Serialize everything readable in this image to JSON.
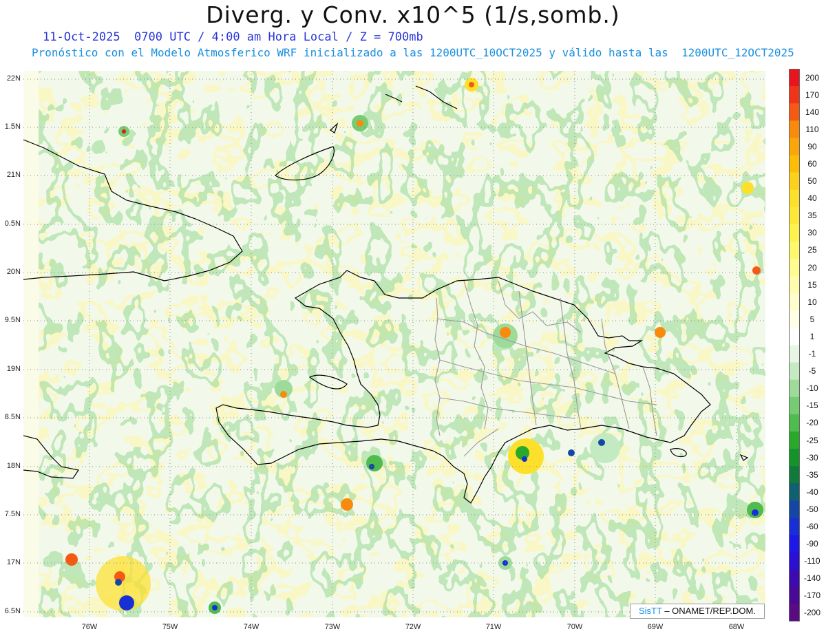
{
  "header": {
    "title": "Diverg. y Conv. x10^5 (1/s,somb.)",
    "subtitle_time": "11-Oct-2025  0700 UTC / 4:00 am Hora Local / Z = 700mb",
    "subtitle_model": "Pronóstico con el Modelo Atmosferico WRF inicializado a las 1200UTC_10OCT2025 y válido hasta las  1200UTC_12OCT2025"
  },
  "axes": {
    "lat_labels": [
      "22N",
      "1.5N",
      "21N",
      "0.5N",
      "20N",
      "9.5N",
      "19N",
      "8.5N",
      "18N",
      "7.5N",
      "17N",
      "6.5N"
    ],
    "lon_labels": [
      "76W",
      "75W",
      "74W",
      "73W",
      "72W",
      "71W",
      "70W",
      "69W",
      "68W"
    ]
  },
  "credit": {
    "brand": "SisTT",
    "text": " – ONAMET/REP.DOM."
  },
  "colorbar": {
    "labels": [
      "200",
      "170",
      "140",
      "110",
      "90",
      "60",
      "50",
      "40",
      "35",
      "30",
      "25",
      "20",
      "15",
      "10",
      "5",
      "1",
      "-1",
      "-5",
      "-10",
      "-15",
      "-20",
      "-25",
      "-30",
      "-35",
      "-40",
      "-50",
      "-60",
      "-90",
      "-110",
      "-140",
      "-170",
      "-200"
    ],
    "colors": [
      "#e8141e",
      "#f03419",
      "#f55a14",
      "#f88a0e",
      "#faa50a",
      "#fbbd06",
      "#fcd11c",
      "#fde02b",
      "#fde83a",
      "#fef24e",
      "#fff76c",
      "#fffb8e",
      "#fffcae",
      "#fffdcc",
      "#fffee6",
      "#ffffff",
      "#e8f6e6",
      "#c4eac2",
      "#9edb9b",
      "#76cc73",
      "#4fbc4d",
      "#2aa82c",
      "#15932b",
      "#0f7a3a",
      "#0f6070",
      "#1446a6",
      "#1730d6",
      "#1c18e8",
      "#2a10d2",
      "#3c0ab0",
      "#4a0896",
      "#5a0a82"
    ]
  }
}
